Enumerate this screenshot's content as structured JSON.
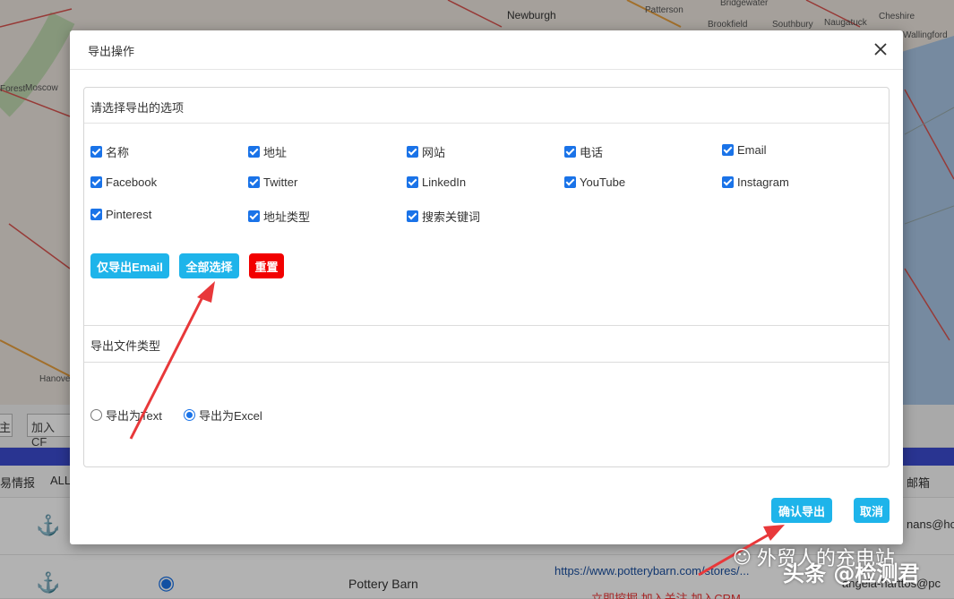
{
  "map": {
    "labels": [
      "Newburgh",
      "Patterson",
      "Bridgewater",
      "Brookfield",
      "Southbury",
      "Naugatuck",
      "Cheshire",
      "Wallingford",
      "Moscow",
      "Forest",
      "Hanove"
    ]
  },
  "background": {
    "input_left": "主",
    "input_crm": "加入CF",
    "col_left": "易情报",
    "col_all": "ALL",
    "col_right": "邮箱",
    "row2_company": "Pottery Barn",
    "row2_url": "https://www.potterybarn.com/stores/...",
    "row2_email": "angela-harttos@pc",
    "row1_email": "nans@ho",
    "row2_actions": "立即挖掘  加入关注  加入CRM"
  },
  "modal": {
    "title": "导出操作",
    "section_options_title": "请选择导出的选项",
    "options": [
      {
        "label": "名称",
        "checked": true
      },
      {
        "label": "地址",
        "checked": true
      },
      {
        "label": "网站",
        "checked": true
      },
      {
        "label": "电话",
        "checked": true
      },
      {
        "label": "Email",
        "checked": true
      },
      {
        "label": "Facebook",
        "checked": true
      },
      {
        "label": "Twitter",
        "checked": true
      },
      {
        "label": "LinkedIn",
        "checked": true
      },
      {
        "label": "YouTube",
        "checked": true
      },
      {
        "label": "Instagram",
        "checked": true
      },
      {
        "label": "Pinterest",
        "checked": true
      },
      {
        "label": "地址类型",
        "checked": true
      },
      {
        "label": "搜索关键词",
        "checked": true
      }
    ],
    "btn_email_only": "仅导出Email",
    "btn_select_all": "全部选择",
    "btn_reset": "重置",
    "section_filetype_title": "导出文件类型",
    "radio_text": "导出为Text",
    "radio_excel": "导出为Excel",
    "selected_filetype": "导出为Excel",
    "btn_confirm": "确认导出",
    "btn_cancel": "取消"
  },
  "watermark": {
    "text": "外贸人的充电站",
    "overlay": "头条 @检测君"
  },
  "colors": {
    "accent_cyan": "#1eb4ea",
    "danger_red": "#f20000",
    "checkbox_blue": "#1a73e8",
    "arrow_red": "#e8383a"
  }
}
